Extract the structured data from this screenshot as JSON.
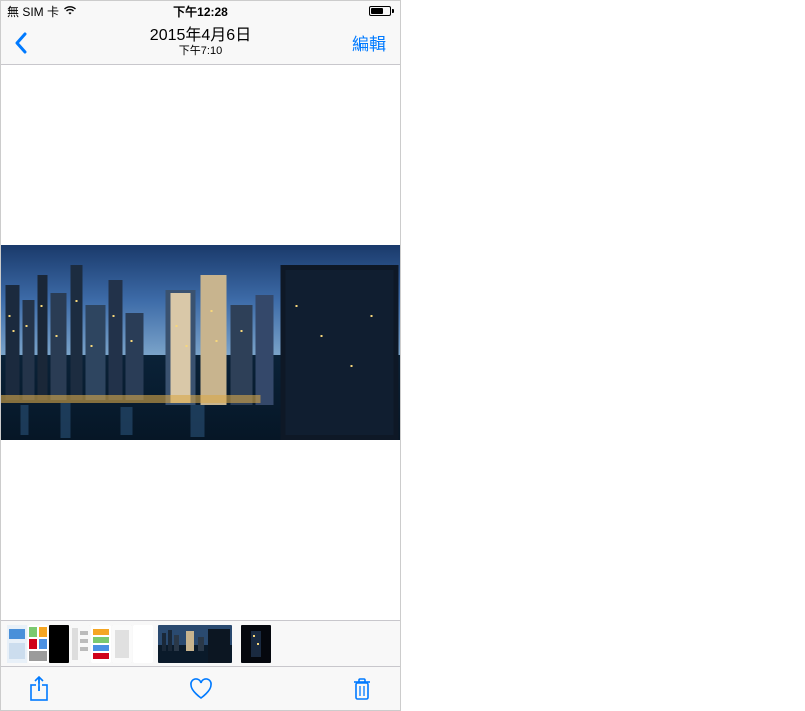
{
  "status_bar": {
    "carrier": "無 SIM 卡",
    "time": "下午12:28"
  },
  "nav": {
    "date": "2015年4月6日",
    "time": "下午7:10",
    "edit_label": "編輯"
  },
  "icons": {
    "back": "back-chevron-icon",
    "wifi": "wifi-icon",
    "battery": "battery-icon",
    "share": "share-icon",
    "favorite": "heart-icon",
    "trash": "trash-icon"
  },
  "colors": {
    "tint": "#007aff",
    "bar_bg": "#f8f8f8",
    "separator": "#c8c7cc"
  },
  "photo": {
    "description": "City skyline panorama at dusk with skyscrapers and marina"
  },
  "thumbnails": {
    "count_before_selected": 7,
    "selected_index": 7,
    "count_after_selected": 1
  }
}
